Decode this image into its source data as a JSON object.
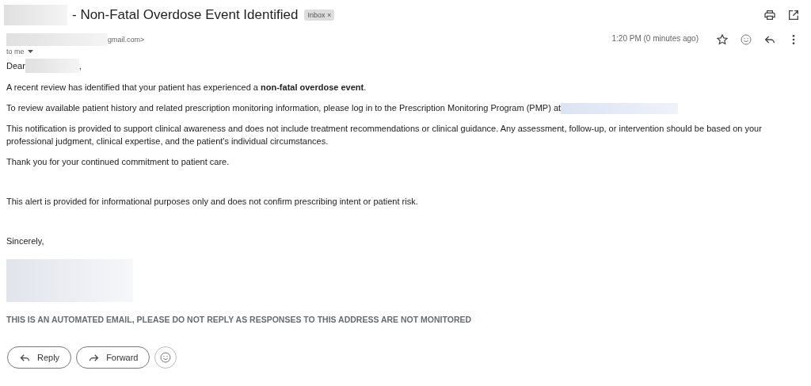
{
  "subject": "- Non-Fatal Overdose Event Identified",
  "label": {
    "text": "Inbox",
    "close": "×"
  },
  "sender": {
    "email": "gmail.com>"
  },
  "recipient": "to me",
  "time": "1:20 PM (0 minutes ago)",
  "body": {
    "greeting": "Dear",
    "greeting_end": ",",
    "paragraphs": [
      {
        "text": "A recent review has identified that your patient has experienced a **non-fatal overdose event**."
      },
      {
        "text": "To review available patient history and related prescription monitoring information, please log in to the Prescription Monitoring Program (PMP) at",
        "link": true
      },
      {
        "text": "This notification is provided to support clinical awareness and does not include treatment recommendations or clinical guidance. Any assessment, follow-up, or intervention should be based on your professional judgment, clinical expertise, and the patient's individual circumstances."
      },
      {
        "text": "Thank you for your continued commitment to patient care."
      },
      {
        "text": "This alert is provided for informational purposes only and does not confirm prescribing intent or patient risk."
      },
      {
        "text": "Sincerely,"
      }
    ],
    "notice": "THIS IS AN AUTOMATED EMAIL, PLEASE DO NOT REPLY AS RESPONSES TO THIS ADDRESS ARE NOT MONITORED"
  },
  "actions": [
    {
      "label": "Reply",
      "kind": "reply"
    },
    {
      "label": "Forward",
      "kind": "forward"
    }
  ]
}
